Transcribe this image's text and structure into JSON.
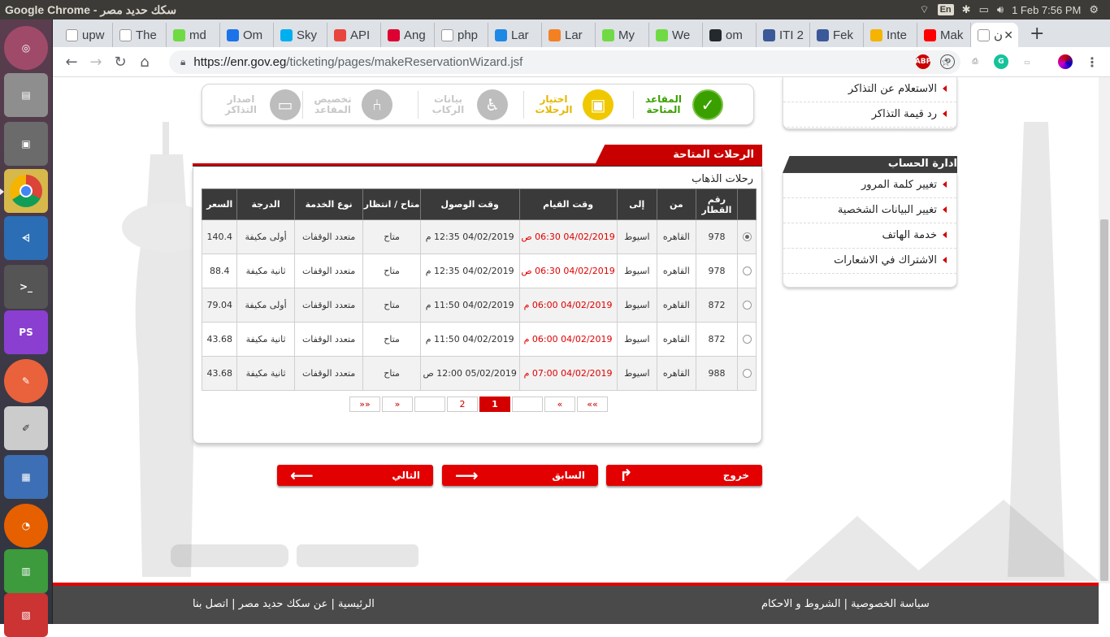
{
  "os": {
    "window_title": "Google Chrome - سكك حديد مصر",
    "lang": "En",
    "datetime": "1 Feb  7:56 PM"
  },
  "browser": {
    "tabs": [
      {
        "label": "upw",
        "icon": "google-icon",
        "color": "#ffffff"
      },
      {
        "label": "The",
        "icon": "pen-icon",
        "color": "#ffffff"
      },
      {
        "label": "md",
        "icon": "upwork-icon",
        "color": "#6fda44"
      },
      {
        "label": "Om",
        "icon": "plane-icon",
        "color": "#1a73e8"
      },
      {
        "label": "Sky",
        "icon": "skype-icon",
        "color": "#00aff0"
      },
      {
        "label": "API",
        "icon": "api-icon",
        "color": "#e8453c"
      },
      {
        "label": "Ang",
        "icon": "angular-icon",
        "color": "#dd0031"
      },
      {
        "label": "php",
        "icon": "php-icon",
        "color": "#ffffff"
      },
      {
        "label": "Lar",
        "icon": "laravel-icon",
        "color": "#1e88e5"
      },
      {
        "label": "Lar",
        "icon": "stack-icon",
        "color": "#f48024"
      },
      {
        "label": "My",
        "icon": "upwork-icon",
        "color": "#6fda44"
      },
      {
        "label": "We",
        "icon": "upwork-icon",
        "color": "#6fda44"
      },
      {
        "label": "om",
        "icon": "github-icon",
        "color": "#24292e"
      },
      {
        "label": "ITI 2",
        "icon": "facebook-icon",
        "color": "#3b5998"
      },
      {
        "label": "Fek",
        "icon": "facebook-icon",
        "color": "#3b5998"
      },
      {
        "label": "Inte",
        "icon": "yellow-icon",
        "color": "#f4b400"
      },
      {
        "label": "Mak",
        "icon": "youtube-icon",
        "color": "#ff0000"
      },
      {
        "label": "ن",
        "icon": "enr-icon",
        "color": "#ffffff"
      }
    ],
    "url_host": "https://enr.gov.eg",
    "url_path": "/ticketing/pages/makeReservationWizard.jsf"
  },
  "wizard": {
    "steps": [
      {
        "label": "المقاعد المتاحة",
        "state": "done",
        "icon": "seat-search-icon"
      },
      {
        "label": "اختيار الرحلات",
        "state": "active",
        "icon": "train-icon"
      },
      {
        "label": "بيانات الركاب",
        "state": "pending",
        "icon": "passenger-icon"
      },
      {
        "label": "تخصيص المقاعد",
        "state": "pending",
        "icon": "seat-icon"
      },
      {
        "label": "اصدار التذاكر",
        "state": "pending",
        "icon": "ticket-icon"
      }
    ]
  },
  "main": {
    "panel_title": "الرحلات المتاحة",
    "section_title": "رحلات الذهاب",
    "columns": [
      "",
      "رقم القطار",
      "من",
      "إلى",
      "وقت القيام",
      "وقت الوصول",
      "متاح / انتظار",
      "نوع الخدمة",
      "الدرجة",
      "السعر"
    ],
    "rows": [
      {
        "selected": true,
        "train": "978",
        "from": "القاهره",
        "to": "اسيوط",
        "dep": "04/02/2019 06:30 ص",
        "arr": "04/02/2019 12:35 م",
        "avail": "متاح",
        "service": "متعدد الوقفات",
        "class": "أولى مكيفة",
        "price": "140.4"
      },
      {
        "selected": false,
        "train": "978",
        "from": "القاهره",
        "to": "اسيوط",
        "dep": "04/02/2019 06:30 ص",
        "arr": "04/02/2019 12:35 م",
        "avail": "متاح",
        "service": "متعدد الوقفات",
        "class": "ثانية مكيفة",
        "price": "88.4"
      },
      {
        "selected": false,
        "train": "872",
        "from": "القاهره",
        "to": "اسيوط",
        "dep": "04/02/2019 06:00 م",
        "arr": "04/02/2019 11:50 م",
        "avail": "متاح",
        "service": "متعدد الوقفات",
        "class": "أولى مكيفة",
        "price": "79.04"
      },
      {
        "selected": false,
        "train": "872",
        "from": "القاهره",
        "to": "اسيوط",
        "dep": "04/02/2019 06:00 م",
        "arr": "04/02/2019 11:50 م",
        "avail": "متاح",
        "service": "متعدد الوقفات",
        "class": "ثانية مكيفة",
        "price": "43.68"
      },
      {
        "selected": false,
        "train": "988",
        "from": "القاهره",
        "to": "اسيوط",
        "dep": "04/02/2019 07:00 م",
        "arr": "05/02/2019 12:00 ص",
        "avail": "متاح",
        "service": "متعدد الوقفات",
        "class": "ثانية مكيفة",
        "price": "43.68"
      }
    ],
    "pager": {
      "first": "««",
      "prev": "«",
      "blank1": "",
      "current": "1",
      "page2": "2",
      "blank2": "",
      "next": "»",
      "last": "»»"
    },
    "buttons": {
      "exit": "خروج",
      "prev": "السابق",
      "next": "التالي"
    }
  },
  "sidebar": {
    "tickets_links": [
      "الاستعلام عن التذاكر",
      "رد قيمة التذاكر"
    ],
    "account_title": "ادارة الحساب",
    "account_links": [
      "تغيير كلمة المرور",
      "تغيير البيانات الشخصية",
      "خدمة الهاتف",
      "الاشتراك في الاشعارات"
    ]
  },
  "footer": {
    "left": "الرئيسية | عن سكك حديد مصر | اتصل بنا",
    "right": "سياسة الخصوصية  |  الشروط و الاحكام"
  },
  "colors": {
    "accent": "#e00000",
    "active_step": "#f0c800",
    "done_step": "#3aa000",
    "pending_step": "#bdbdbd"
  }
}
